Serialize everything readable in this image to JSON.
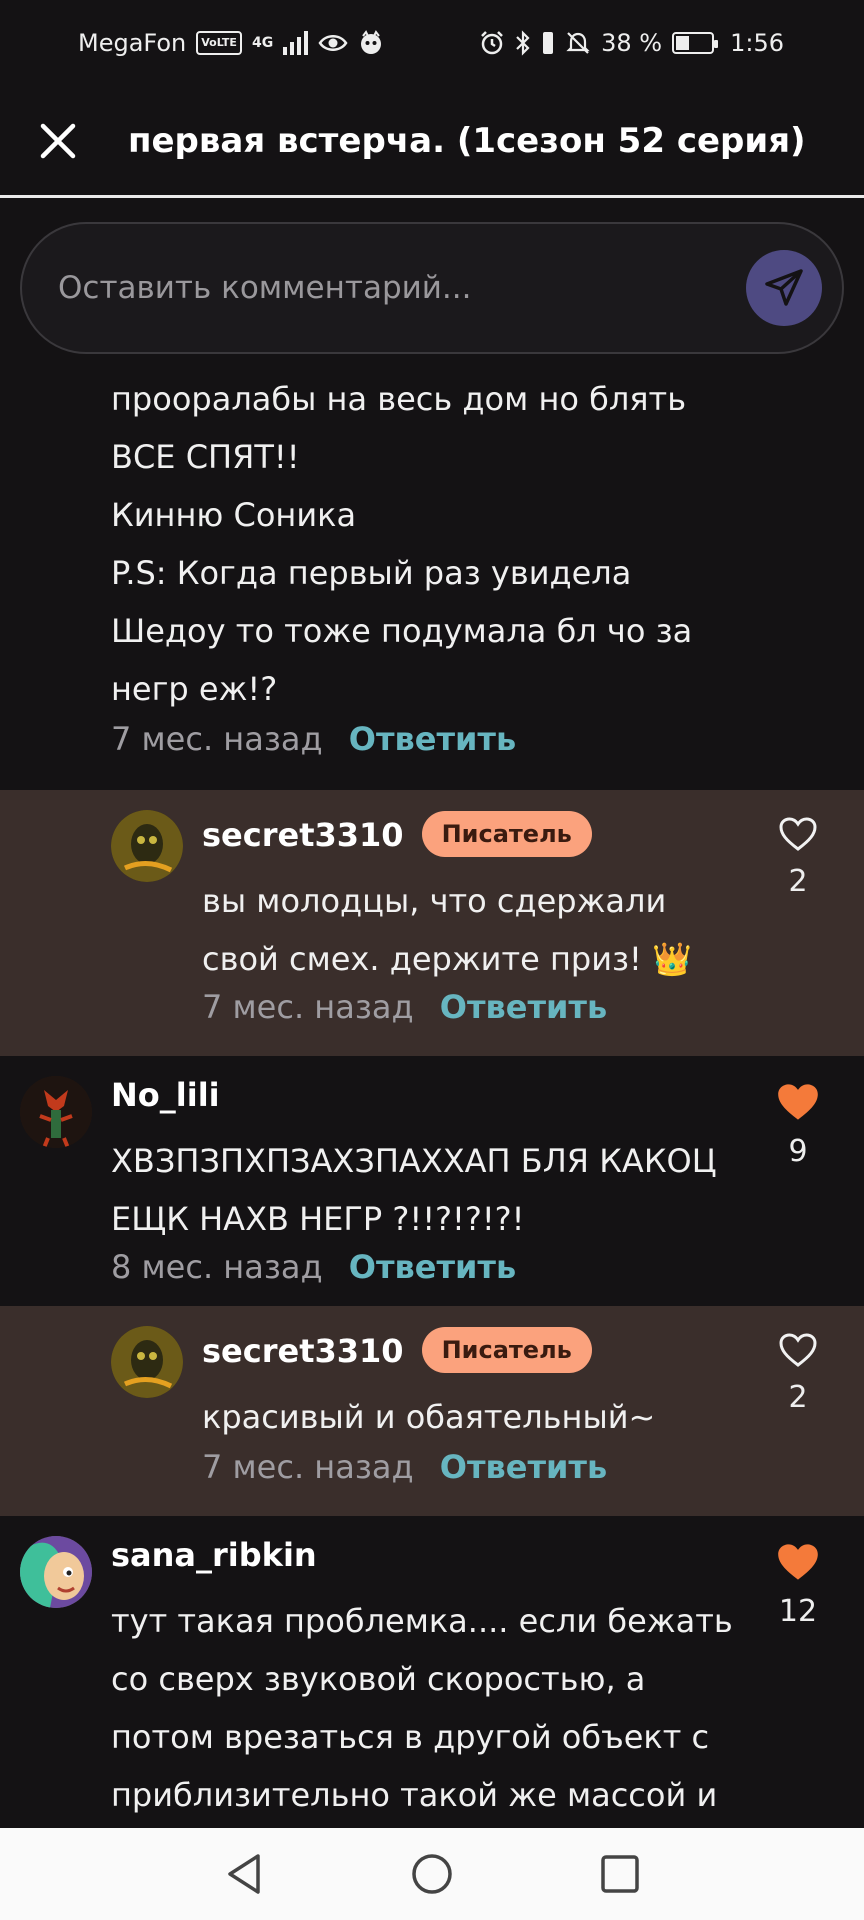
{
  "status_bar": {
    "carrier": "MegaFon",
    "volte": "VoLTE",
    "network": "4G",
    "battery": "38 %",
    "battery_level": 0.38,
    "time": "1:56"
  },
  "header": {
    "title": "первая встерча. (1сезон 52 серия)"
  },
  "comment_input": {
    "placeholder": "Оставить комментарий..."
  },
  "comments": [
    {
      "lines": [
        "прооралабы на весь дом но блять",
        "ВСЕ СПЯТ!!",
        "Кинню Соника",
        "P.S: Когда первый раз увидела",
        "Шедоу то тоже подумала бл чо за",
        "негр еж!?"
      ],
      "time": "7 мес. назад",
      "reply_label": "Ответить"
    },
    {
      "username": "secret3310",
      "badge": "Писатель",
      "lines": [
        "вы молодцы, что сдержали",
        "свой смех. держите приз! 👑"
      ],
      "time": "7 мес. назад",
      "reply_label": "Ответить",
      "likes": "2",
      "liked": false
    },
    {
      "username": "No_lili",
      "lines": [
        "ХВЗПЗПХПЗАХЗПАХХАП БЛЯ КАКОЦ",
        "ЕЩК НАХВ НЕГР ?!!?!?!?!"
      ],
      "time": "8 мес. назад",
      "reply_label": "Ответить",
      "likes": "9",
      "liked": true
    },
    {
      "username": "secret3310",
      "badge": "Писатель",
      "lines": [
        "красивый и обаятельный~"
      ],
      "time": "7 мес. назад",
      "reply_label": "Ответить",
      "likes": "2",
      "liked": false
    },
    {
      "username": "sana_ribkin",
      "lines": [
        "тут такая проблемка.... если бежать",
        "со сверх звуковой скоростью, а",
        "потом врезаться в другой объект с",
        "приблизительно такой же массой и"
      ],
      "likes": "12",
      "liked": true
    }
  ],
  "colors": {
    "background": "#141214",
    "reply_background": "#3a2e2b",
    "reply_link": "#67b5c0",
    "badge": "#fba27d",
    "like_active": "#f47a3a",
    "send_button": "#4e4a82"
  }
}
